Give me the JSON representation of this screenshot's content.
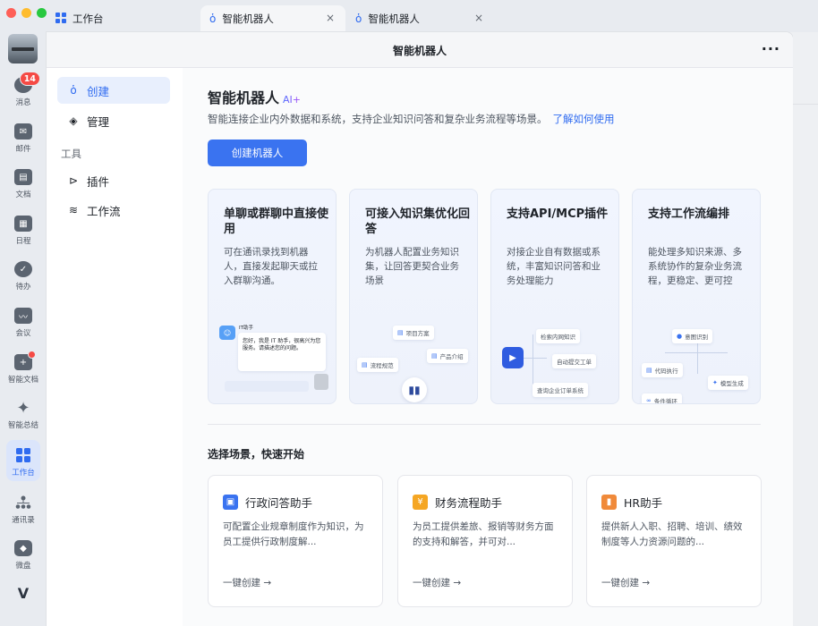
{
  "colors": {
    "accent": "#2f6bf0",
    "button": "#3a73f0",
    "badge": "#f54a45",
    "traffic_red": "#fe5f57",
    "traffic_yellow": "#febc2e",
    "traffic_green": "#28c840"
  },
  "rail": {
    "items": [
      {
        "label": "消息",
        "icon": "chat-bubble-icon",
        "badge": "14"
      },
      {
        "label": "邮件",
        "icon": "mail-icon"
      },
      {
        "label": "文档",
        "icon": "doc-icon"
      },
      {
        "label": "日程",
        "icon": "calendar-icon"
      },
      {
        "label": "待办",
        "icon": "check-circle-icon"
      },
      {
        "label": "会议",
        "icon": "video-icon"
      },
      {
        "label": "智能文档",
        "icon": "smart-doc-icon"
      },
      {
        "label": "智能总结",
        "icon": "sparkle-icon"
      },
      {
        "label": "工作台",
        "icon": "grid-icon"
      },
      {
        "label": "通讯录",
        "icon": "org-chart-icon"
      },
      {
        "label": "微盘",
        "icon": "disk-icon"
      }
    ]
  },
  "tabs": [
    {
      "label": "工作台",
      "icon": "grid-icon"
    },
    {
      "label": "智能机器人",
      "icon": "robot-icon",
      "close": "×"
    },
    {
      "label": "智能机器人",
      "icon": "robot-icon",
      "close": "×"
    }
  ],
  "window": {
    "title": "智能机器人",
    "more": "···"
  },
  "sidenav": {
    "create": "创建",
    "manage": "管理",
    "section_tools": "工具",
    "plugins": "插件",
    "workflow": "工作流"
  },
  "main": {
    "title": "智能机器人",
    "ai_tag": "AI+",
    "description": "智能连接企业内外数据和系统，支持企业知识问答和复杂业务流程等场景。",
    "learn_link": "了解如何使用",
    "create_button": "创建机器人",
    "features": [
      {
        "title": "单聊或群聊中直接使用",
        "desc": "可在通讯录找到机器人，直接发起聊天或拉入群聊沟通。"
      },
      {
        "title": "可接入知识集优化回答",
        "desc": "为机器人配置业务知识集，让回答更契合业务场景"
      },
      {
        "title": "支持API/MCP插件",
        "desc": "对接企业自有数据或系统，丰富知识问答和业务处理能力"
      },
      {
        "title": "支持工作流编排",
        "desc": "能处理多知识来源、多系统协作的复杂业务流程，更稳定、更可控"
      }
    ],
    "illus1": {
      "name": "IT助手",
      "bubble": "您好，我是 IT 助手，很高兴为您服务。请描述您的问题。"
    },
    "illus2": {
      "chip1": "项目方案",
      "chip2": "产品介绍",
      "chip3": "流程规范"
    },
    "illus3": {
      "chip1": "检索内网知识",
      "chip2": "自动提交工单",
      "chip3": "查询企业订单系统"
    },
    "illus4": {
      "chip1": "意图识别",
      "chip2": "代码执行",
      "chip3": "模型生成",
      "chip4": "条件循环"
    },
    "scenes_heading": "选择场景，快速开始",
    "scenes": [
      {
        "title": "行政问答助手",
        "desc": "可配置企业规章制度作为知识，为员工提供行政制度解...",
        "cta": "一键创建 →",
        "color": "#3a73f0",
        "icon": "person-card-icon"
      },
      {
        "title": "财务流程助手",
        "desc": "为员工提供差旅、报销等财务方面的支持和解答，并可对...",
        "cta": "一键创建 →",
        "color": "#f5a623",
        "icon": "yen-icon"
      },
      {
        "title": "HR助手",
        "desc": "提供新人入职、招聘、培训、绩效制度等人力资源问题的...",
        "cta": "一键创建 →",
        "color": "#f08a3a",
        "icon": "id-badge-icon"
      }
    ]
  }
}
